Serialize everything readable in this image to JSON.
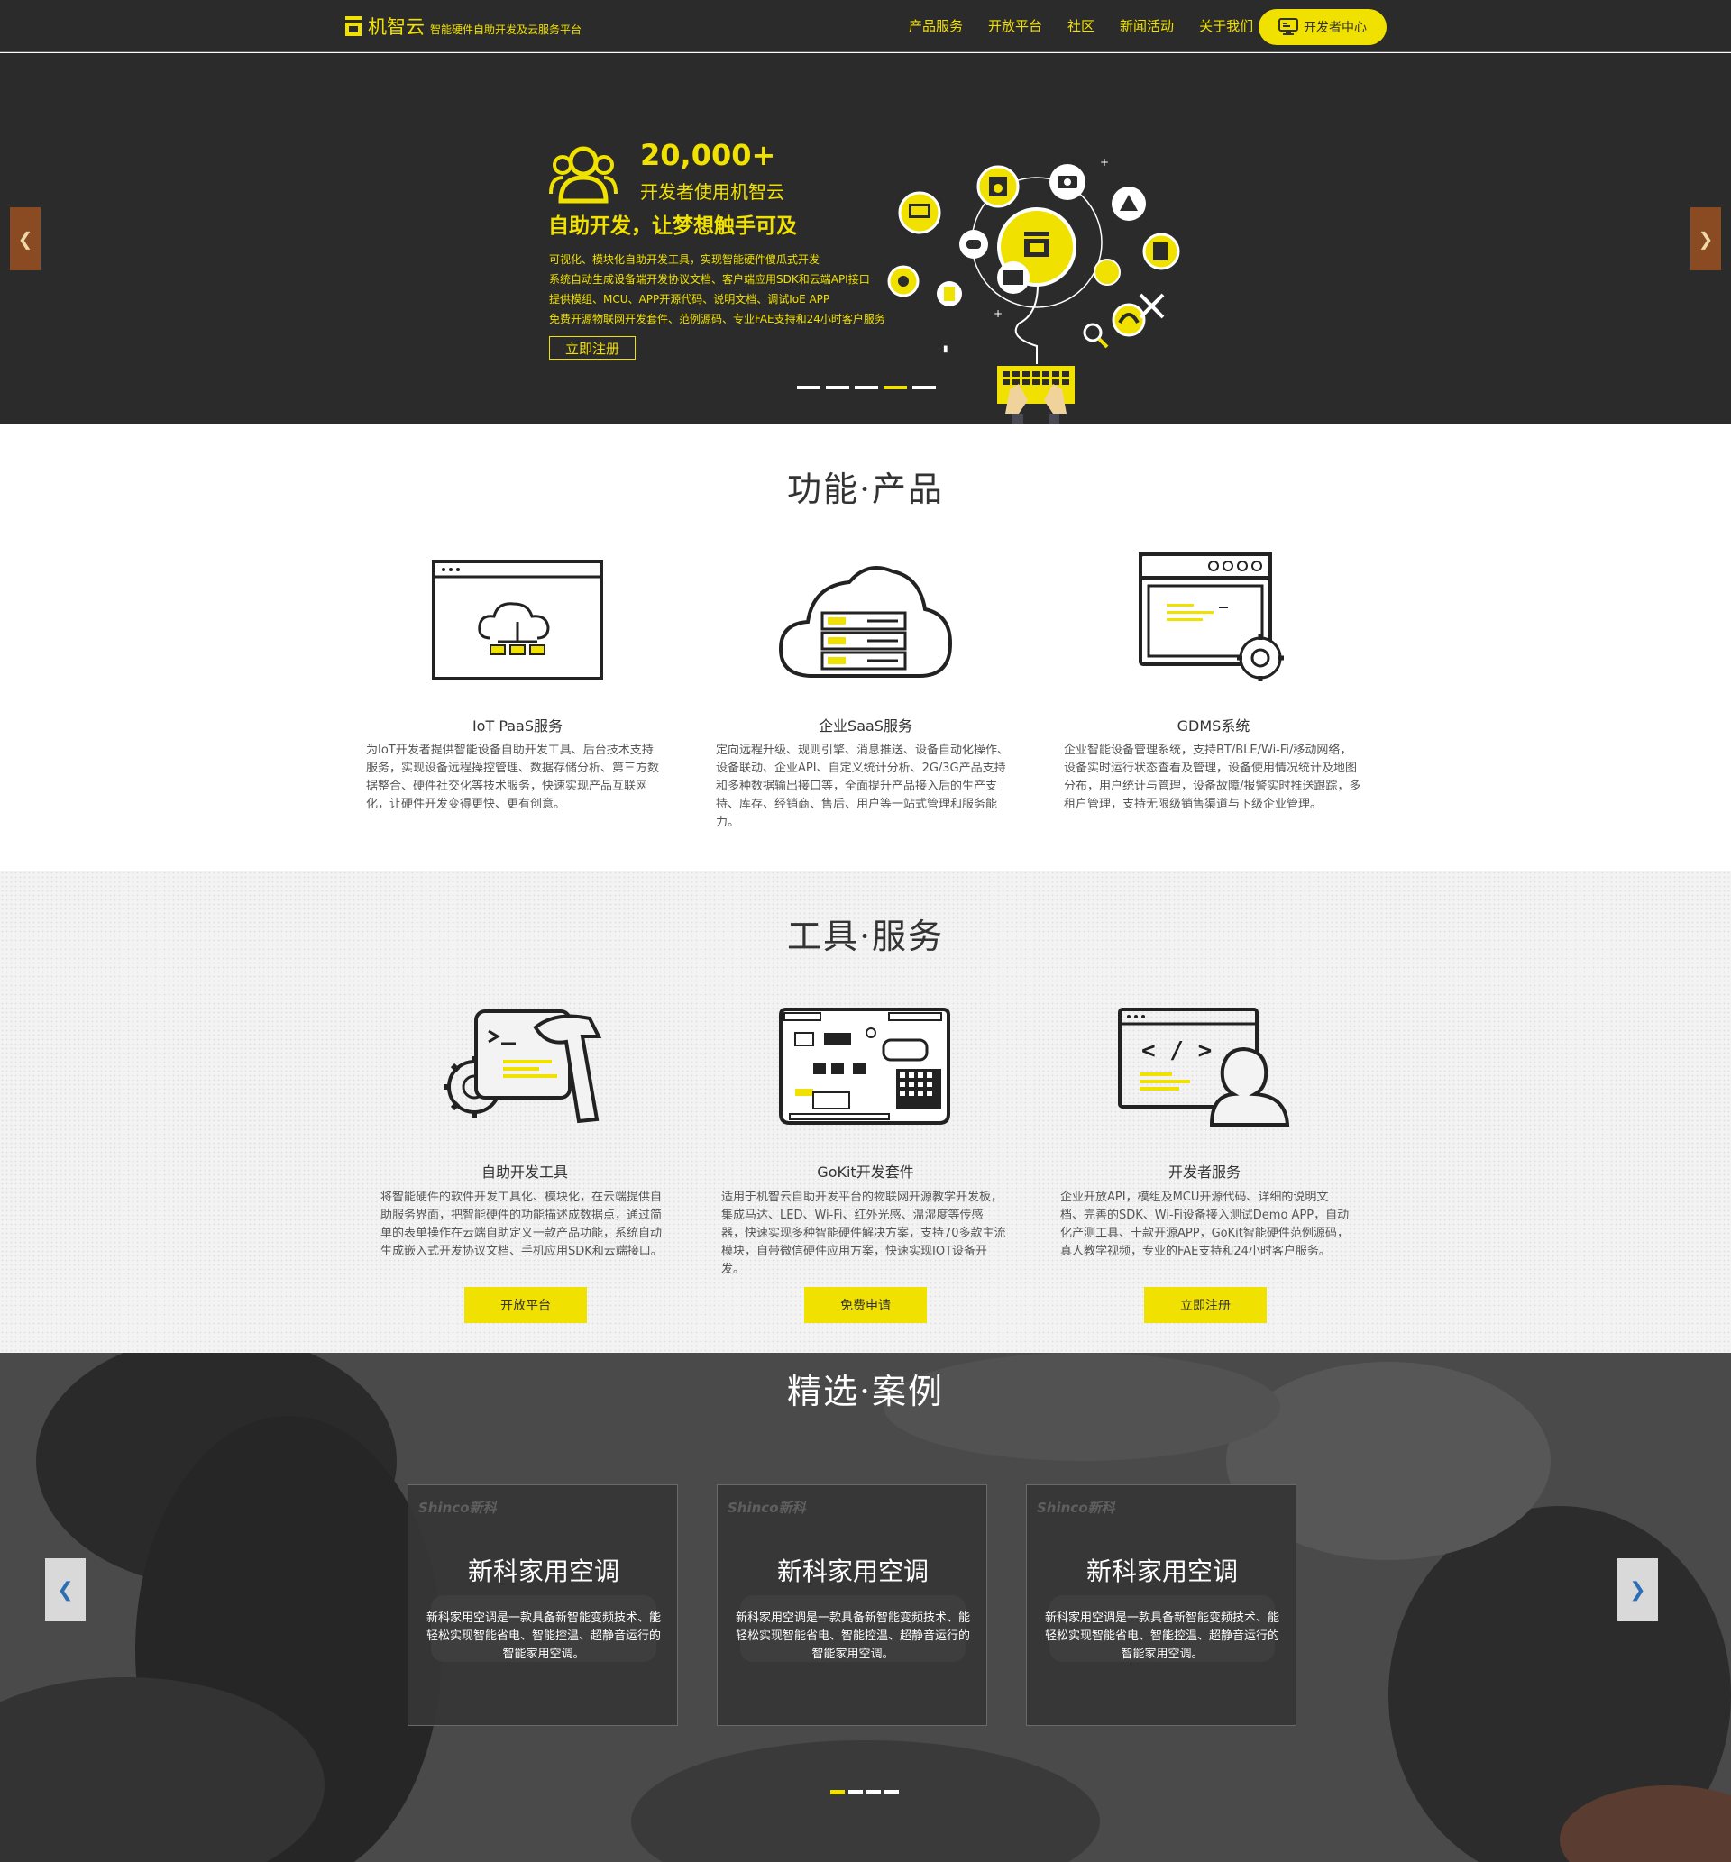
{
  "nav": {
    "brand": "机智云",
    "tagline": "智能硬件自助开发及云服务平台",
    "menu": [
      "产品服务",
      "开放平台",
      "社区",
      "新闻活动",
      "关于我们"
    ],
    "dev_center": "开发者中心"
  },
  "hero": {
    "count": "20,000+",
    "count_sub": "开发者使用机智云",
    "title": "自助开发，让梦想触手可及",
    "features": [
      "可视化、模块化自助开发工具，实现智能硬件傻瓜式开发",
      "系统自动生成设备端开发协议文档、客户端应用SDK和云端API接口",
      "提供模组、MCU、APP开源代码、说明文档、调试IoE APP",
      "免费开源物联网开发套件、范例源码、专业FAE支持和24小时客户服务"
    ],
    "register": "立即注册",
    "prev": "❮",
    "next": "❯",
    "slides": 5,
    "active_slide": 4
  },
  "products": {
    "title": "功能·产品",
    "items": [
      {
        "name": "IoT PaaS服务",
        "desc": "为IoT开发者提供智能设备自助开发工具、后台技术支持服务，实现设备远程操控管理、数据存储分析、第三方数据整合、硬件社交化等技术服务，快速实现产品互联网化，让硬件开发变得更快、更有创意。"
      },
      {
        "name": "企业SaaS服务",
        "desc": "定向远程升级、规则引擎、消息推送、设备自动化操作、设备联动、企业API、自定义统计分析、2G/3G产品支持和多种数据输出接口等，全面提升产品接入后的生产支持、库存、经销商、售后、用户等一站式管理和服务能力。"
      },
      {
        "name": "GDMS系统",
        "desc": "企业智能设备管理系统，支持BT/BLE/Wi-Fi/移动网络，设备实时运行状态查看及管理，设备使用情况统计及地图分布，用户统计与管理，设备故障/报警实时推送跟踪，多租户管理，支持无限级销售渠道与下级企业管理。"
      }
    ]
  },
  "tools": {
    "title": "工具·服务",
    "items": [
      {
        "name": "自助开发工具",
        "desc": "将智能硬件的软件开发工具化、模块化，在云端提供自助服务界面，把智能硬件的功能描述成数据点，通过简单的表单操作在云端自助定义一款产品功能，系统自动生成嵌入式开发协议文档、手机应用SDK和云端接口。",
        "button": "开放平台"
      },
      {
        "name": "GoKit开发套件",
        "desc": "适用于机智云自助开发平台的物联网开源教学开发板，集成马达、LED、Wi-Fi、红外光感、温湿度等传感器，快速实现多种智能硬件解决方案，支持70多款主流模块，自带微信硬件应用方案，快速实现IOT设备开发。",
        "button": "免费申请"
      },
      {
        "name": "开发者服务",
        "desc": "企业开放API，模组及MCU开源代码、详细的说明文档、完善的SDK、Wi-Fi设备接入测试Demo APP，自动化产测工具、十款开源APP，GoKit智能硬件范例源码，真人教学视频，专业的FAE支持和24小时客户服务。",
        "button": "立即注册"
      }
    ]
  },
  "cases": {
    "title": "精选·案例",
    "prev": "❮",
    "next": "❯",
    "items": [
      {
        "brand": "Shinco新科",
        "name": "新科家用空调",
        "desc": "新科家用空调是一款具备新智能变频技术、能轻松实现智能省电、智能控温、超静音运行的智能家用空调。"
      },
      {
        "brand": "Shinco新科",
        "name": "新科家用空调",
        "desc": "新科家用空调是一款具备新智能变频技术、能轻松实现智能省电、智能控温、超静音运行的智能家用空调。"
      },
      {
        "brand": "Shinco新科",
        "name": "新科家用空调",
        "desc": "新科家用空调是一款具备新智能变频技术、能轻松实现智能省电、智能控温、超静音运行的智能家用空调。"
      }
    ],
    "slides": 4,
    "active_slide": 1
  },
  "colors": {
    "accent": "#f0e100",
    "dark": "#2b2b2b",
    "arrow": "#8a4a22"
  }
}
